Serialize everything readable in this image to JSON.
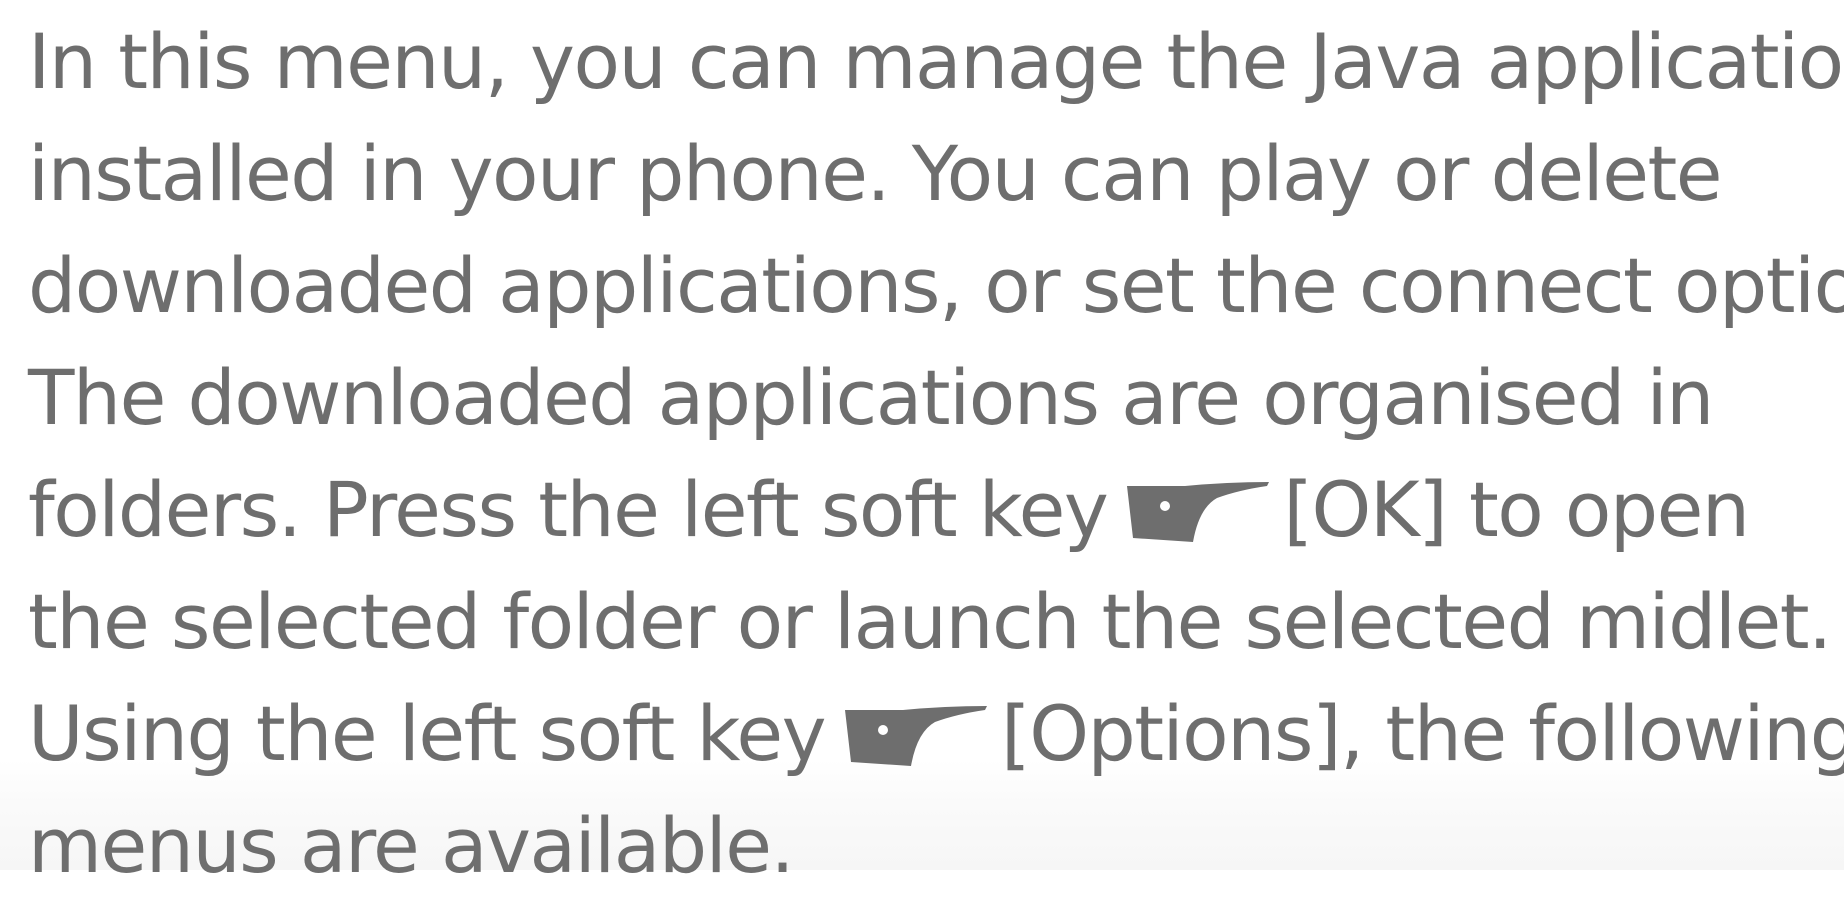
{
  "document": {
    "lines": [
      "In this menu, you can manage the Java applications",
      "installed in your phone. You can play or delete",
      "downloaded applications, or set the connect option.",
      "The downloaded applications are organised in"
    ],
    "line5": {
      "before": "folders. Press the left soft key",
      "after": "[OK] to open"
    },
    "line6": "the selected folder or launch the selected midlet.",
    "line7": {
      "before": "Using the left soft key",
      "after": "[Options], the following"
    },
    "line8": "menus are available.",
    "icons": {
      "softkey": "left-soft-key-icon",
      "color": "#6e6e6e"
    }
  }
}
